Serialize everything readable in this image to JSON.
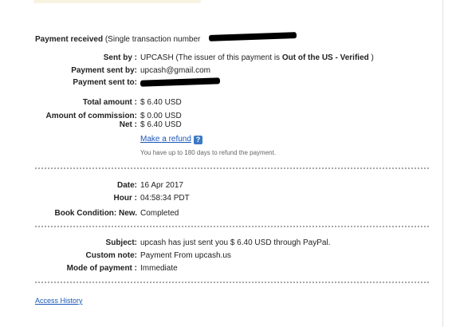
{
  "header": {
    "title": "Payment received",
    "subtitle": "(Single transaction number"
  },
  "details": {
    "sent_by": {
      "label": "Sent by :",
      "value": "UPCASH (The issuer of this payment is ",
      "bold": "Out of the US - Verified",
      "suffix": " )"
    },
    "sent_by_email": {
      "label": "Payment sent by:",
      "value": "upcash@gmail.com"
    },
    "sent_to": {
      "label": "Payment sent to:",
      "value": ""
    }
  },
  "amounts": {
    "total": {
      "label": "Total amount :",
      "value": "$ 6.40 USD"
    },
    "commission": {
      "label": "Amount of commission:",
      "value": "$ 0.00 USD"
    },
    "net": {
      "label": "Net :",
      "value": "$ 6.40 USD"
    },
    "refund_link": "Make a refund",
    "refund_note": "You have up to 180 days to refund the payment."
  },
  "timing": {
    "date": {
      "label": "Date:",
      "value": "16 Apr 2017"
    },
    "hour": {
      "label": "Hour :",
      "value": "04:58:34 PDT"
    },
    "book": {
      "label": "Book Condition: New.",
      "value": "Completed"
    }
  },
  "message": {
    "subject": {
      "label": "Subject:",
      "value": "upcash has just sent you $ 6.40 USD through PayPal."
    },
    "custom_note": {
      "label": "Custom note:",
      "value": "Payment From upcash.us"
    },
    "mode": {
      "label": "Mode of payment :",
      "value": "Immediate"
    }
  },
  "footer": {
    "access_history": "Access History"
  },
  "icons": {
    "help": "question-mark-icon"
  },
  "colors": {
    "link": "#1b56b8",
    "help_icon": "#3c78c6",
    "divider": "#a8a8a8"
  }
}
